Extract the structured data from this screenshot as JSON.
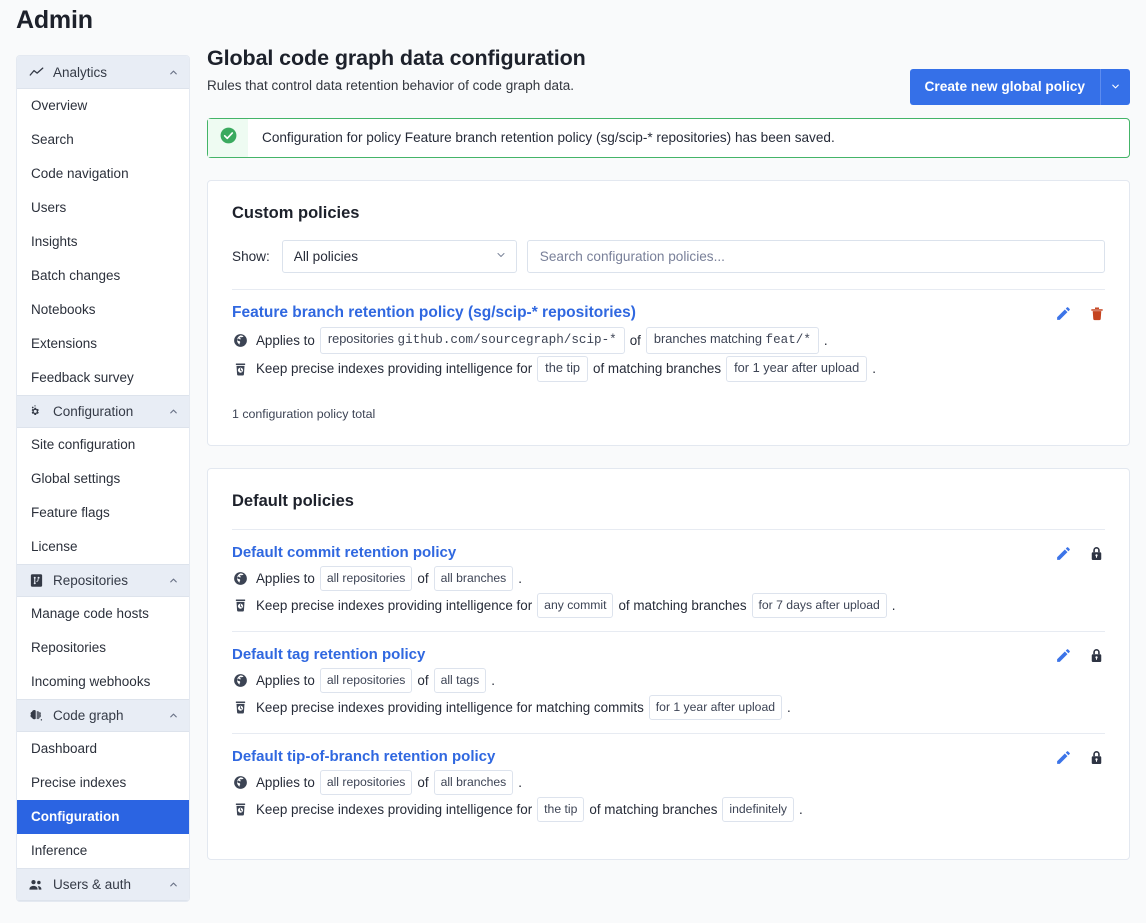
{
  "app": {
    "title": "Admin"
  },
  "sidebar": {
    "groups": [
      {
        "label": "Analytics",
        "icon": "line-chart-icon",
        "items": [
          {
            "label": "Overview",
            "active": false
          },
          {
            "label": "Search",
            "active": false
          },
          {
            "label": "Code navigation",
            "active": false
          },
          {
            "label": "Users",
            "active": false
          },
          {
            "label": "Insights",
            "active": false
          },
          {
            "label": "Batch changes",
            "active": false
          },
          {
            "label": "Notebooks",
            "active": false
          },
          {
            "label": "Extensions",
            "active": false
          },
          {
            "label": "Feedback survey",
            "active": false
          }
        ]
      },
      {
        "label": "Configuration",
        "icon": "cog-icon",
        "items": [
          {
            "label": "Site configuration",
            "active": false
          },
          {
            "label": "Global settings",
            "active": false
          },
          {
            "label": "Feature flags",
            "active": false
          },
          {
            "label": "License",
            "active": false
          }
        ]
      },
      {
        "label": "Repositories",
        "icon": "source-repository-icon",
        "items": [
          {
            "label": "Manage code hosts",
            "active": false
          },
          {
            "label": "Repositories",
            "active": false
          },
          {
            "label": "Incoming webhooks",
            "active": false
          }
        ]
      },
      {
        "label": "Code graph",
        "icon": "brain-icon",
        "items": [
          {
            "label": "Dashboard",
            "active": false
          },
          {
            "label": "Precise indexes",
            "active": false
          },
          {
            "label": "Configuration",
            "active": true
          },
          {
            "label": "Inference",
            "active": false
          }
        ]
      },
      {
        "label": "Users & auth",
        "icon": "people-icon",
        "items": []
      }
    ]
  },
  "header": {
    "title": "Global code graph data configuration",
    "subtitle": "Rules that control data retention behavior of code graph data.",
    "create_button_label": "Create new global policy"
  },
  "alert": {
    "icon": "check-circle-icon",
    "message": "Configuration for policy Feature branch retention policy (sg/scip-* repositories) has been saved.",
    "border_color": "#44b468",
    "icon_bg": "#eefbf2"
  },
  "custom_policies": {
    "title": "Custom policies",
    "show_label": "Show:",
    "show_value": "All policies",
    "show_options": [
      "All policies"
    ],
    "search_placeholder": "Search configuration policies...",
    "total": "1 configuration policy total",
    "policies": [
      {
        "name": "Feature branch retention policy (sg/scip-* repositories)",
        "applies_prefix": "Applies to",
        "applies_badge_label": "repositories",
        "applies_badge_code": "github.com/sourcegraph/scip-*",
        "applies_mid": "of",
        "applies_badge2_label": "branches matching",
        "applies_badge2_code": "feat/*",
        "retention_prefix": "Keep precise indexes providing intelligence for",
        "retention_badge": "the tip",
        "retention_mid": "of matching branches",
        "retention_duration": "for 1 year after upload",
        "actions": [
          "edit-icon",
          "delete-icon"
        ]
      }
    ]
  },
  "default_policies": {
    "title": "Default policies",
    "policies": [
      {
        "name": "Default commit retention policy",
        "applies_prefix": "Applies to",
        "applies_badge1": "all repositories",
        "applies_mid": "of",
        "applies_badge2": "all branches",
        "retention_prefix": "Keep precise indexes providing intelligence for",
        "retention_badge": "any commit",
        "retention_mid": "of matching branches",
        "retention_duration": "for 7 days after upload",
        "actions": [
          "edit-icon",
          "lock-icon"
        ]
      },
      {
        "name": "Default tag retention policy",
        "applies_prefix": "Applies to",
        "applies_badge1": "all repositories",
        "applies_mid": "of",
        "applies_badge2": "all tags",
        "retention_prefix": "Keep precise indexes providing intelligence for matching commits",
        "retention_badge": "",
        "retention_mid": "",
        "retention_duration": "for 1 year after upload",
        "actions": [
          "edit-icon",
          "lock-icon"
        ]
      },
      {
        "name": "Default tip-of-branch retention policy",
        "applies_prefix": "Applies to",
        "applies_badge1": "all repositories",
        "applies_mid": "of",
        "applies_badge2": "all branches",
        "retention_prefix": "Keep precise indexes providing intelligence for",
        "retention_badge": "the tip",
        "retention_mid": "of matching branches",
        "retention_duration": "indefinitely",
        "actions": [
          "edit-icon",
          "lock-icon"
        ]
      }
    ]
  },
  "colors": {
    "primary": "#3570e8",
    "link": "#3068e0",
    "active_nav": "#2b64e2",
    "success": "#44b468",
    "danger": "#c5431f",
    "page_bg": "#f9fafb"
  }
}
